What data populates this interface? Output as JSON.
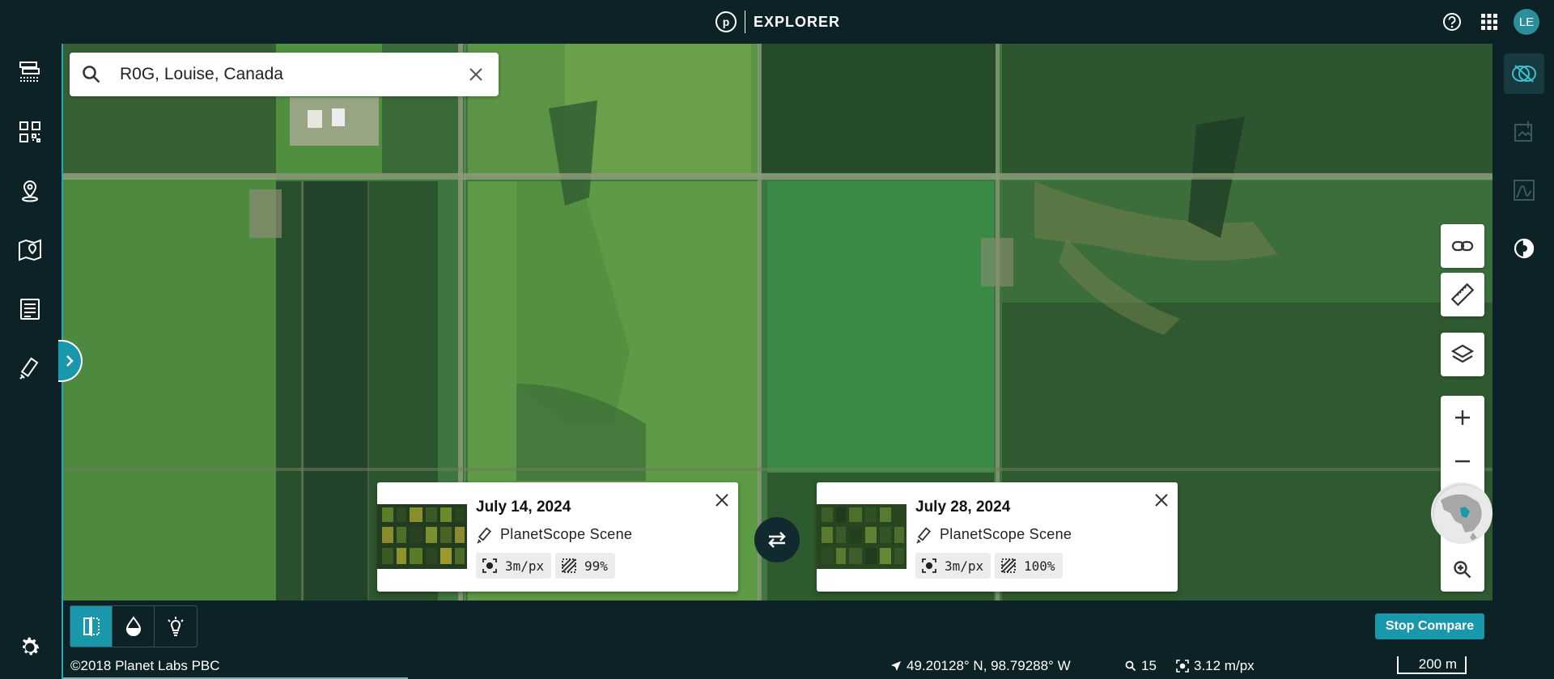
{
  "app": {
    "name": "EXPLORER",
    "logo_letter": "p",
    "user_initials": "LE",
    "accent_color": "#1a98ab"
  },
  "search": {
    "value": "R0G, Louise, Canada"
  },
  "scenes": [
    {
      "date": "July 14, 2024",
      "type": "PlanetScope Scene",
      "resolution": "3m/px",
      "coverage": "99%"
    },
    {
      "date": "July 28, 2024",
      "type": "PlanetScope Scene",
      "resolution": "3m/px",
      "coverage": "100%"
    }
  ],
  "bottom_toolbar": {
    "stop_compare_label": "Stop Compare"
  },
  "status": {
    "copyright": "©2018 Planet Labs PBC",
    "coordinates": "49.20128° N, 98.79288° W",
    "zoom": "15",
    "resolution": "3.12 m/px",
    "scale": "200 m"
  },
  "icons": {
    "left_rail": [
      "scenes-icon",
      "mosaics-icon",
      "places-icon",
      "map-pin-icon",
      "reports-icon",
      "satellite-icon",
      "settings-icon"
    ],
    "right_rail": [
      "compare-icon",
      "add-image-icon",
      "spectral-icon",
      "timelapse-icon"
    ],
    "map_tools": [
      "link-icon",
      "ruler-icon",
      "layers-icon",
      "zoom-in-icon",
      "zoom-out-icon",
      "globe-icon",
      "zoom-search-icon"
    ],
    "compare_modes": [
      "split-view-icon",
      "opacity-icon",
      "spotlight-icon"
    ]
  }
}
